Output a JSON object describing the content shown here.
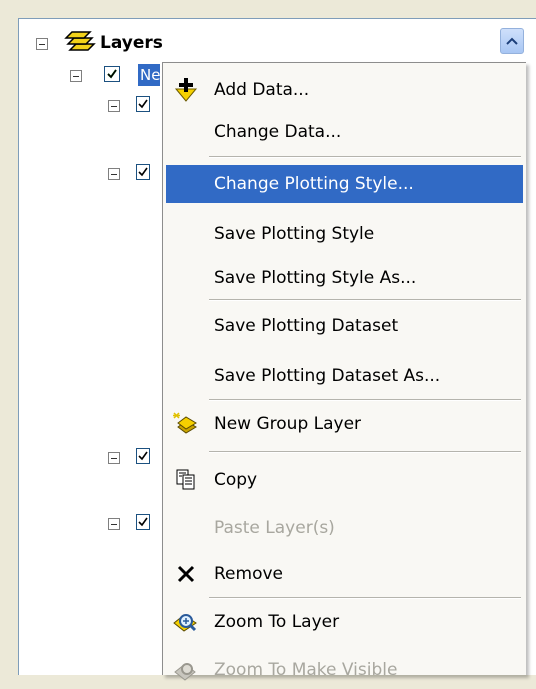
{
  "toc": {
    "root_label": "Layers",
    "selected_layer_visible_text": "Ne"
  },
  "menu": {
    "items": [
      {
        "label": "Add Data...",
        "icon": "add-data-icon"
      },
      {
        "label": "Change Data...",
        "icon": ""
      },
      {
        "label": "Change Plotting Style...",
        "icon": "",
        "highlighted": true
      },
      {
        "label": "Save Plotting Style",
        "icon": ""
      },
      {
        "label": "Save Plotting Style As...",
        "icon": ""
      },
      {
        "label": "Save Plotting Dataset",
        "icon": ""
      },
      {
        "label": "Save Plotting Dataset As...",
        "icon": ""
      },
      {
        "label": "New Group Layer",
        "icon": "new-group-layer-icon"
      },
      {
        "label": "Copy",
        "icon": "copy-icon"
      },
      {
        "label": "Paste Layer(s)",
        "icon": "",
        "disabled": true
      },
      {
        "label": "Remove",
        "icon": "remove-icon"
      },
      {
        "label": "Zoom To Layer",
        "icon": "zoom-to-layer-icon"
      },
      {
        "label": "Zoom To Make Visible",
        "icon": "zoom-to-make-visible-icon",
        "disabled": true
      }
    ]
  },
  "colors": {
    "highlight": "#316ac5",
    "disabled_text": "#a8a79f",
    "menu_background": "#f9f8f4"
  }
}
